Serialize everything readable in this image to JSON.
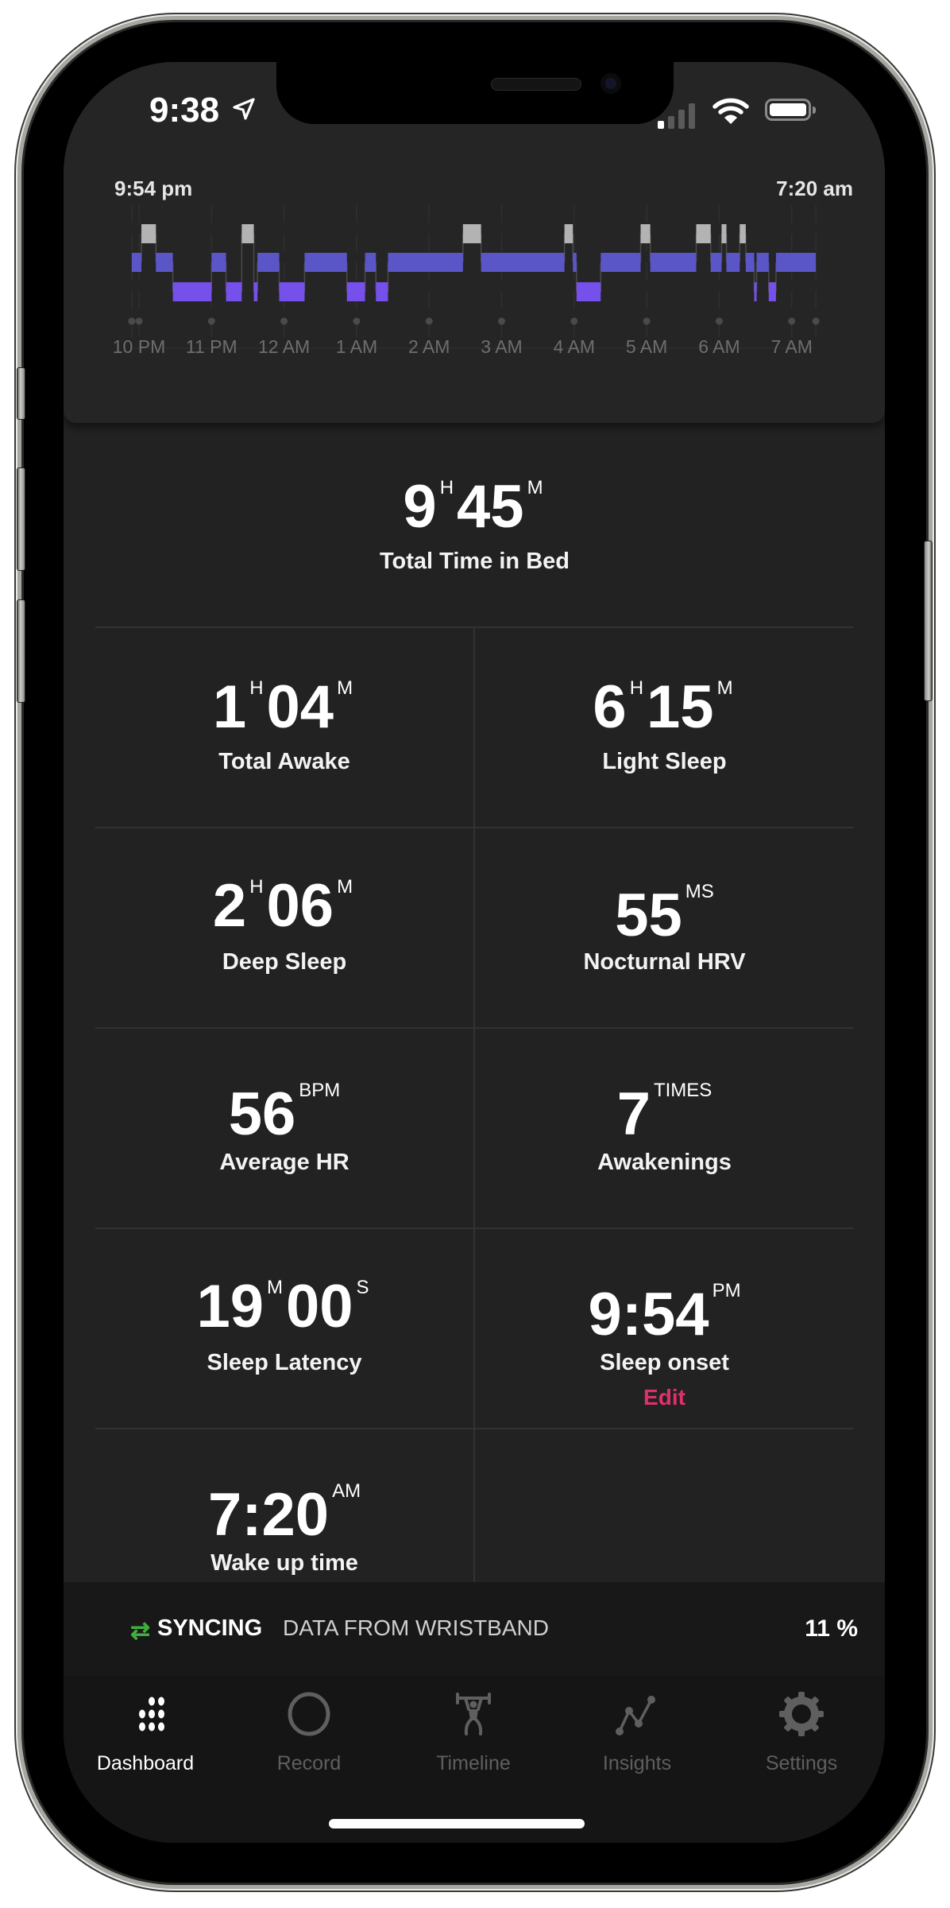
{
  "status_bar": {
    "time": "9:38",
    "icons": [
      "location-arrow-icon",
      "cellular-signal-icon",
      "wifi-icon",
      "battery-icon"
    ]
  },
  "header": {
    "start_time": "9:54 pm",
    "end_time": "7:20 am"
  },
  "chart_data": {
    "type": "hypnogram",
    "title": "",
    "xlabel": "",
    "ylabel": "",
    "x_unit": "minutes after 10 PM",
    "x_range": [
      -6,
      560
    ],
    "levels": [
      "awake",
      "light",
      "deep"
    ],
    "colors": {
      "awake": "#b3b3b3",
      "light": "#5b56c8",
      "deep": "#7650ea"
    },
    "tick_labels": [
      "10 PM",
      "11 PM",
      "12 AM",
      "1 AM",
      "2 AM",
      "3 AM",
      "4 AM",
      "5 AM",
      "6 AM",
      "7 AM"
    ],
    "tick_values": [
      0,
      60,
      120,
      180,
      240,
      300,
      360,
      420,
      480,
      540
    ],
    "marker_values": [
      -6,
      0,
      60,
      120,
      180,
      240,
      300,
      360,
      420,
      480,
      540,
      560
    ],
    "segments": [
      {
        "stage": "light",
        "start": -6,
        "end": 2
      },
      {
        "stage": "awake",
        "start": 2,
        "end": 14
      },
      {
        "stage": "light",
        "start": 14,
        "end": 28
      },
      {
        "stage": "deep",
        "start": 28,
        "end": 60
      },
      {
        "stage": "light",
        "start": 60,
        "end": 72
      },
      {
        "stage": "deep",
        "start": 72,
        "end": 85
      },
      {
        "stage": "awake",
        "start": 85,
        "end": 95
      },
      {
        "stage": "deep",
        "start": 95,
        "end": 98
      },
      {
        "stage": "light",
        "start": 98,
        "end": 116
      },
      {
        "stage": "deep",
        "start": 116,
        "end": 137
      },
      {
        "stage": "light",
        "start": 137,
        "end": 172
      },
      {
        "stage": "deep",
        "start": 172,
        "end": 187
      },
      {
        "stage": "light",
        "start": 187,
        "end": 196
      },
      {
        "stage": "deep",
        "start": 196,
        "end": 206
      },
      {
        "stage": "light",
        "start": 206,
        "end": 268
      },
      {
        "stage": "awake",
        "start": 268,
        "end": 283
      },
      {
        "stage": "light",
        "start": 283,
        "end": 352
      },
      {
        "stage": "awake",
        "start": 352,
        "end": 359
      },
      {
        "stage": "light",
        "start": 359,
        "end": 362
      },
      {
        "stage": "deep",
        "start": 362,
        "end": 382
      },
      {
        "stage": "light",
        "start": 382,
        "end": 415
      },
      {
        "stage": "awake",
        "start": 415,
        "end": 423
      },
      {
        "stage": "light",
        "start": 423,
        "end": 461
      },
      {
        "stage": "awake",
        "start": 461,
        "end": 473
      },
      {
        "stage": "light",
        "start": 473,
        "end": 482
      },
      {
        "stage": "awake",
        "start": 482,
        "end": 486
      },
      {
        "stage": "light",
        "start": 486,
        "end": 497
      },
      {
        "stage": "awake",
        "start": 497,
        "end": 502
      },
      {
        "stage": "light",
        "start": 502,
        "end": 509
      },
      {
        "stage": "deep",
        "start": 509,
        "end": 511
      },
      {
        "stage": "light",
        "start": 511,
        "end": 521
      },
      {
        "stage": "deep",
        "start": 521,
        "end": 527
      },
      {
        "stage": "light",
        "start": 527,
        "end": 560
      }
    ]
  },
  "stats": {
    "total_in_bed": {
      "label": "Total Time in Bed",
      "hours": "9",
      "h_unit": "H",
      "minutes": "45",
      "m_unit": "M"
    },
    "total_awake": {
      "label": "Total Awake",
      "hours": "1",
      "h_unit": "H",
      "minutes": "04",
      "m_unit": "M"
    },
    "light_sleep": {
      "label": "Light Sleep",
      "hours": "6",
      "h_unit": "H",
      "minutes": "15",
      "m_unit": "M"
    },
    "deep_sleep": {
      "label": "Deep Sleep",
      "hours": "2",
      "h_unit": "H",
      "minutes": "06",
      "m_unit": "M"
    },
    "hrv": {
      "label": "Nocturnal HRV",
      "value": "55",
      "unit": "MS"
    },
    "avg_hr": {
      "label": "Average HR",
      "value": "56",
      "unit": "BPM"
    },
    "awakenings": {
      "label": "Awakenings",
      "value": "7",
      "unit": "TIMES"
    },
    "latency": {
      "label": "Sleep Latency",
      "minutes": "19",
      "m_unit": "M",
      "seconds": "00",
      "s_unit": "S"
    },
    "onset": {
      "label": "Sleep onset",
      "value": "9:54",
      "unit": "PM",
      "edit_label": "Edit"
    },
    "wake": {
      "label": "Wake up time",
      "value": "7:20",
      "unit": "AM"
    }
  },
  "sync": {
    "icon": "sync-arrows-icon",
    "strong": "SYNCING",
    "rest": "DATA FROM WRISTBAND",
    "percent": "11 %",
    "accent": "#3fae3f"
  },
  "tabs": [
    {
      "label": "Dashboard",
      "icon": "dots-grid-icon",
      "active": true
    },
    {
      "label": "Record",
      "icon": "circle-icon",
      "active": false
    },
    {
      "label": "Timeline",
      "icon": "weightlifter-icon",
      "active": false
    },
    {
      "label": "Insights",
      "icon": "line-chart-icon",
      "active": false
    },
    {
      "label": "Settings",
      "icon": "gear-icon",
      "active": false
    }
  ],
  "colors": {
    "edit": "#e0306c",
    "background": "#222222"
  }
}
